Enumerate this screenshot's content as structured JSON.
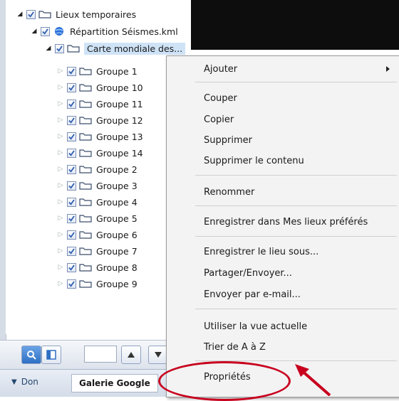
{
  "tree": {
    "items": [
      {
        "label": "Lieux temporaires",
        "state": "open",
        "icon": "folder-icon"
      },
      {
        "label": "Répartition Séismes.kml",
        "state": "open",
        "icon": "globe-icon"
      },
      {
        "label": "Carte mondiale des...",
        "state": "open",
        "icon": "folder-icon",
        "selected": true
      },
      {
        "label": "Groupe 1",
        "state": "closed"
      },
      {
        "label": "Groupe 10",
        "state": "closed"
      },
      {
        "label": "Groupe 11",
        "state": "closed"
      },
      {
        "label": "Groupe 12",
        "state": "closed"
      },
      {
        "label": "Groupe 13",
        "state": "closed"
      },
      {
        "label": "Groupe 14",
        "state": "closed"
      },
      {
        "label": "Groupe 2",
        "state": "closed"
      },
      {
        "label": "Groupe 3",
        "state": "closed"
      },
      {
        "label": "Groupe 4",
        "state": "closed"
      },
      {
        "label": "Groupe 5",
        "state": "closed"
      },
      {
        "label": "Groupe 6",
        "state": "closed"
      },
      {
        "label": "Groupe 7",
        "state": "closed"
      },
      {
        "label": "Groupe 8",
        "state": "closed"
      },
      {
        "label": "Groupe 9",
        "state": "closed"
      }
    ]
  },
  "bottom_tabs": {
    "tab1": "Don",
    "tab2": "Galerie Google"
  },
  "context_menu": {
    "items": [
      {
        "label": "Ajouter",
        "has_submenu": true
      },
      {
        "label": "Couper"
      },
      {
        "label": "Copier"
      },
      {
        "label": "Supprimer"
      },
      {
        "label": "Supprimer le contenu"
      },
      {
        "label": "Renommer"
      },
      {
        "label": "Enregistrer dans Mes lieux préférés"
      },
      {
        "label": "Enregistrer le lieu sous..."
      },
      {
        "label": "Partager/Envoyer..."
      },
      {
        "label": "Envoyer par e-mail..."
      },
      {
        "label": "Utiliser la vue actuelle"
      },
      {
        "label": "Trier de A à Z"
      },
      {
        "label": "Propriétés"
      }
    ]
  },
  "colors": {
    "annotation": "#c8001e",
    "selection": "#cfe3f7",
    "checkbox_check": "#2f5fb3"
  }
}
